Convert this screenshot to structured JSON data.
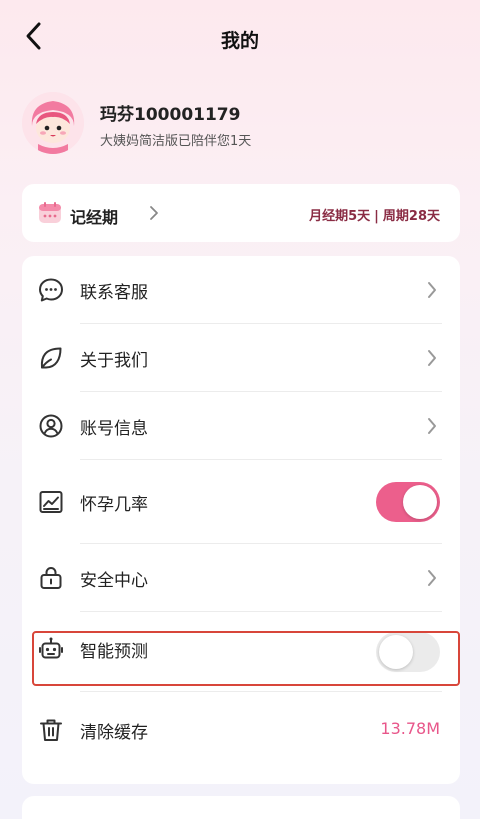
{
  "header": {
    "title": "我的"
  },
  "profile": {
    "name": "玛芬100001179",
    "subtitle": "大姨妈简洁版已陪伴您1天"
  },
  "period": {
    "label": "记经期",
    "cycle_info_left": "月经期5天",
    "separator": "|",
    "cycle_info_right": "周期28天"
  },
  "menu": {
    "items": [
      {
        "label": "联系客服",
        "icon": "chat-icon"
      },
      {
        "label": "关于我们",
        "icon": "leaf-icon"
      },
      {
        "label": "账号信息",
        "icon": "user-icon"
      },
      {
        "label": "怀孕几率",
        "icon": "chart-icon",
        "toggle": "on"
      },
      {
        "label": "安全中心",
        "icon": "lock-icon"
      },
      {
        "label": "智能预测",
        "icon": "robot-icon",
        "toggle": "off"
      },
      {
        "label": "清除缓存",
        "icon": "trash-icon",
        "value": "13.78M"
      }
    ]
  },
  "colors": {
    "accent": "#ec5f8c",
    "period_text": "#8a2c44",
    "cache_value": "#e8568a",
    "highlight_border": "#d8463a"
  }
}
